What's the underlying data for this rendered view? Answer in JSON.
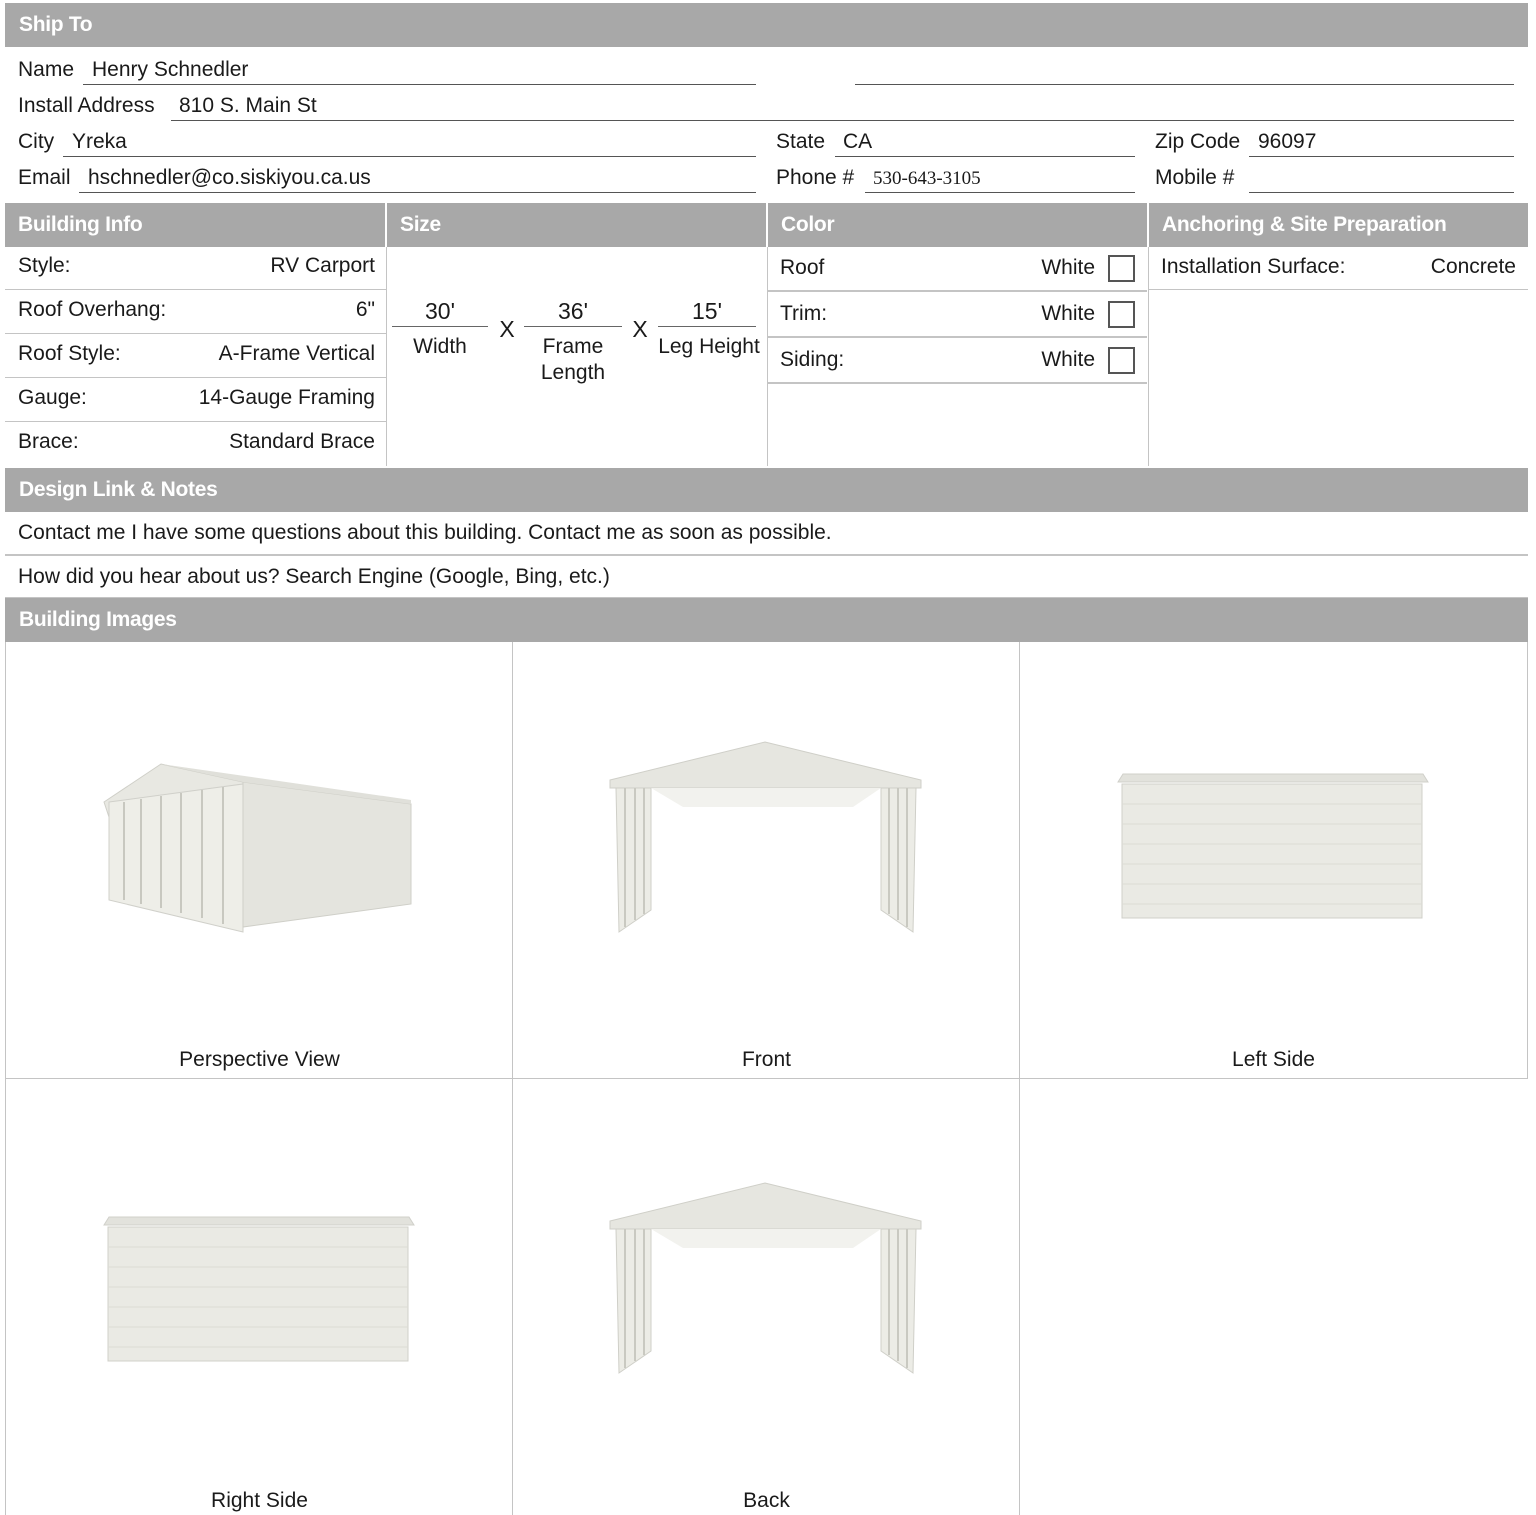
{
  "ship_to": {
    "header": "Ship To",
    "name_label": "Name",
    "name": "Henry Schnedler",
    "address_label": "Install Address",
    "address": "810 S. Main St",
    "city_label": "City",
    "city": "Yreka",
    "state_label": "State",
    "state": "CA",
    "zip_label": "Zip Code",
    "zip": "96097",
    "email_label": "Email",
    "email": "hschnedler@co.siskiyou.ca.us",
    "phone_label": "Phone #",
    "phone": "530-643-3105",
    "mobile_label": "Mobile #",
    "mobile": ""
  },
  "building_info": {
    "header": "Building Info",
    "rows": [
      {
        "label": "Style:",
        "value": "RV Carport"
      },
      {
        "label": "Roof Overhang:",
        "value": "6\""
      },
      {
        "label": "Roof Style:",
        "value": "A-Frame Vertical"
      },
      {
        "label": "Gauge:",
        "value": "14-Gauge Framing"
      },
      {
        "label": "Brace:",
        "value": "Standard Brace"
      }
    ]
  },
  "size": {
    "header": "Size",
    "width": "30'",
    "width_label": "Width",
    "length": "36'",
    "length_label_1": "Frame",
    "length_label_2": "Length",
    "height": "15'",
    "height_label": "Leg Height",
    "times": "X"
  },
  "color": {
    "header": "Color",
    "rows": [
      {
        "label": "Roof",
        "value": "White",
        "swatch": "#ffffff"
      },
      {
        "label": "Trim:",
        "value": "White",
        "swatch": "#ffffff"
      },
      {
        "label": "Siding:",
        "value": "White",
        "swatch": "#ffffff"
      }
    ]
  },
  "anchoring": {
    "header": "Anchoring & Site Preparation",
    "surface_label": "Installation Surface:",
    "surface": "Concrete"
  },
  "notes": {
    "header": "Design Link & Notes",
    "comment": "Contact me I have some questions about this building. Contact me as soon as possible.",
    "referral": "How did you hear about us? Search Engine (Google, Bing, etc.)"
  },
  "images": {
    "header": "Building Images",
    "captions": [
      "Perspective View",
      "Front",
      "Left Side",
      "Right Side",
      "Back"
    ]
  },
  "colors": {
    "header_bg": "#a8a8a8",
    "header_text": "#ffffff",
    "building": "#e6e6e0"
  }
}
